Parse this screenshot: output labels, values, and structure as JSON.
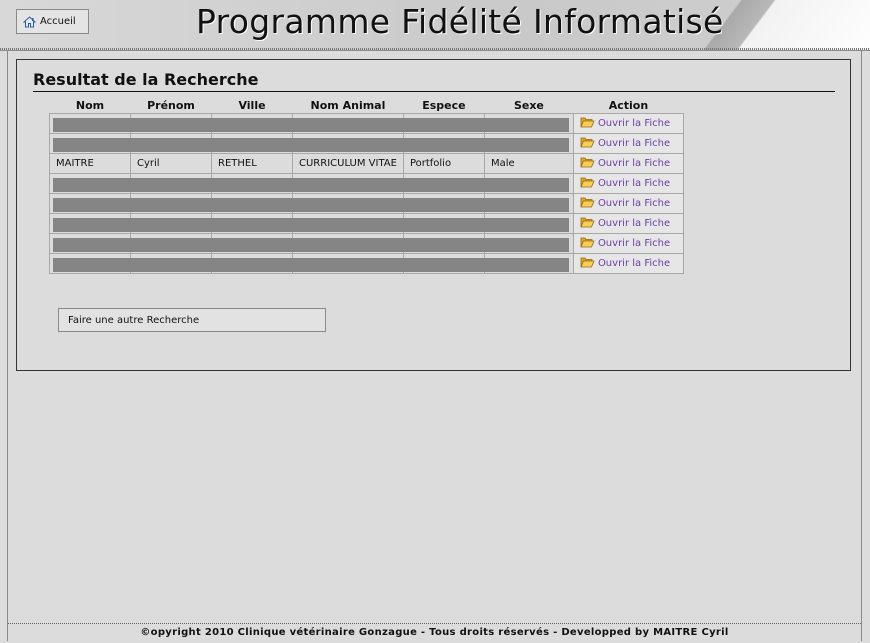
{
  "header": {
    "home_label": "Accueil",
    "app_title": "Programme Fidélité Informatisé"
  },
  "panel": {
    "title": "Resultat de la Recherche"
  },
  "table": {
    "columns": [
      "Nom",
      "Prénom",
      "Ville",
      "Nom Animal",
      "Espece",
      "Sexe",
      "Action"
    ],
    "rows": [
      {
        "masked": true,
        "cells": [
          "",
          "",
          "",
          "",
          "",
          ""
        ],
        "action": "Ouvrir la Fiche"
      },
      {
        "masked": true,
        "cells": [
          "",
          "",
          "",
          "",
          "",
          ""
        ],
        "action": "Ouvrir la Fiche"
      },
      {
        "masked": false,
        "cells": [
          "MAITRE",
          "Cyril",
          "RETHEL",
          "CURRICULUM VITAE",
          "Portfolio",
          "Male"
        ],
        "action": "Ouvrir la Fiche"
      },
      {
        "masked": true,
        "cells": [
          "",
          "",
          "",
          "",
          "",
          ""
        ],
        "action": "Ouvrir la Fiche"
      },
      {
        "masked": true,
        "cells": [
          "",
          "",
          "",
          "",
          "",
          ""
        ],
        "action": "Ouvrir la Fiche"
      },
      {
        "masked": true,
        "cells": [
          "",
          "",
          "",
          "",
          "",
          ""
        ],
        "action": "Ouvrir la Fiche"
      },
      {
        "masked": true,
        "cells": [
          "",
          "",
          "",
          "",
          "",
          ""
        ],
        "action": "Ouvrir la Fiche"
      },
      {
        "masked": true,
        "cells": [
          "",
          "",
          "",
          "",
          "",
          ""
        ],
        "action": "Ouvrir la Fiche"
      }
    ]
  },
  "search_again_label": "Faire une autre Recherche",
  "footer": {
    "text": "©opyright 2010 Clinique vétérinaire Gonzague - Tous droits réservés - Developped by MAITRE Cyril"
  },
  "colors": {
    "link": "#6a3fa6",
    "mask": "#858585",
    "background": "#dcdcdc"
  },
  "icons": {
    "home": "house-icon",
    "open": "folder-open-icon"
  }
}
